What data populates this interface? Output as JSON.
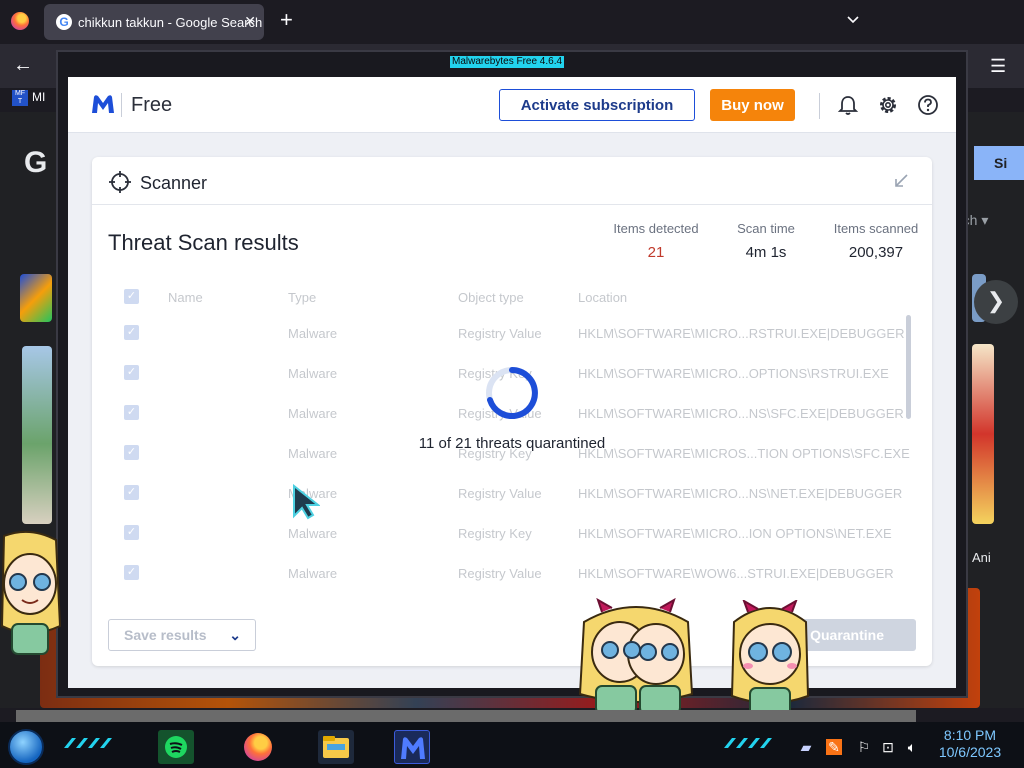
{
  "browser": {
    "tab_title": "chikkun takkun - Google Search",
    "tab_close": "✕",
    "new_tab": "+",
    "back": "←",
    "menu": "☰",
    "bookmark_label": "MI",
    "bookmark_icon_text": "MF T",
    "google_letter": "G",
    "sign_in": "Si",
    "search_tools": "rch ▾",
    "next_arrow": "❯",
    "ani_label": "Ani"
  },
  "malwarebytes": {
    "window_title": "Malwarebytes Free  4.6.4",
    "edition": "Free",
    "activate_label": "Activate subscription",
    "buy_label": "Buy now",
    "accent_color": "#1d3b8b",
    "buy_color": "#f5840b",
    "scanner": {
      "title": "Scanner",
      "results_title": "Threat Scan results",
      "stats": [
        {
          "label": "Items detected",
          "value": "21"
        },
        {
          "label": "Scan time",
          "value": "4m 1s"
        },
        {
          "label": "Items scanned",
          "value": "200,397"
        }
      ],
      "columns": [
        "Name",
        "Type",
        "Object type",
        "Location"
      ],
      "rows": [
        {
          "type": "Malware",
          "object_type": "Registry Value",
          "location": "HKLM\\SOFTWARE\\MICRO...RSTRUI.EXE|DEBUGGER"
        },
        {
          "type": "Malware",
          "object_type": "Registry Key",
          "location": "HKLM\\SOFTWARE\\MICRO...OPTIONS\\RSTRUI.EXE"
        },
        {
          "type": "Malware",
          "object_type": "Registry Value",
          "location": "HKLM\\SOFTWARE\\MICRO...NS\\SFC.EXE|DEBUGGER"
        },
        {
          "type": "Malware",
          "object_type": "Registry Key",
          "location": "HKLM\\SOFTWARE\\MICROS...TION OPTIONS\\SFC.EXE"
        },
        {
          "type": "Malware",
          "object_type": "Registry Value",
          "location": "HKLM\\SOFTWARE\\MICRO...NS\\NET.EXE|DEBUGGER"
        },
        {
          "type": "Malware",
          "object_type": "Registry Key",
          "location": "HKLM\\SOFTWARE\\MICRO...ION OPTIONS\\NET.EXE"
        },
        {
          "type": "Malware",
          "object_type": "Registry Value",
          "location": "HKLM\\SOFTWARE\\WOW6...STRUI.EXE|DEBUGGER"
        }
      ],
      "progress_text": "11 of 21 threats quarantined",
      "save_label": "Save results",
      "quarantine_label": "Quarantine"
    }
  },
  "taskbar": {
    "time": "8:10 PM",
    "date": "10/6/2023"
  }
}
